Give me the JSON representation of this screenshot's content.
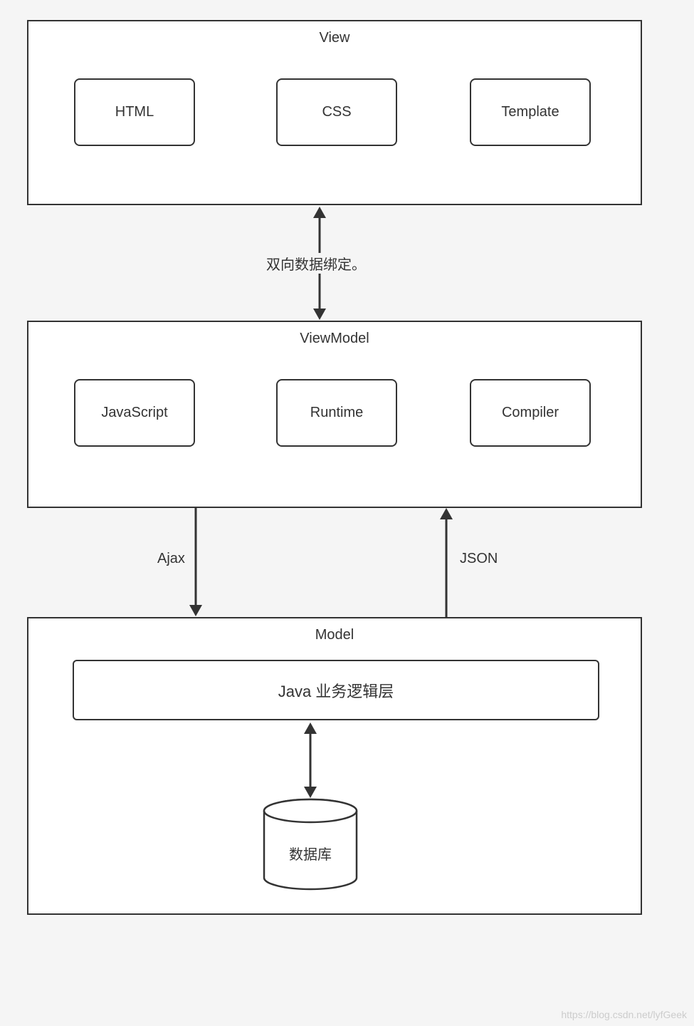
{
  "layers": {
    "view": {
      "title": "View",
      "items": [
        "HTML",
        "CSS",
        "Template"
      ]
    },
    "viewmodel": {
      "title": "ViewModel",
      "items": [
        "JavaScript",
        "Runtime",
        "Compiler"
      ]
    },
    "model": {
      "title": "Model",
      "business": "Java 业务逻辑层",
      "database": "数据库"
    }
  },
  "connectors": {
    "view_vm": "双向数据绑定。",
    "ajax": "Ajax",
    "json": "JSON"
  },
  "watermark": "https://blog.csdn.net/lyfGeek"
}
